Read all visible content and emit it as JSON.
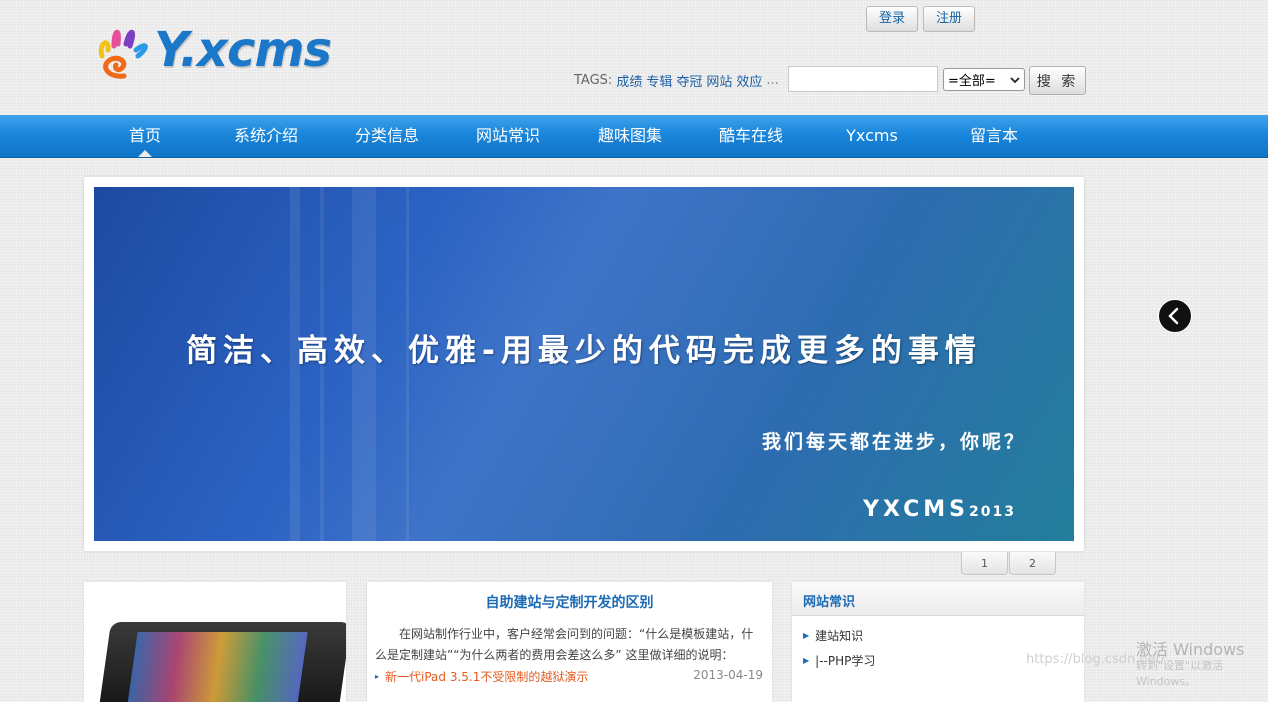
{
  "header": {
    "logo_text": "Y.xcms",
    "login_label": "登录",
    "register_label": "注册",
    "tags_label": "TAGS:",
    "tags": [
      "成绩",
      "专辑",
      "夺冠",
      "网站",
      "效应"
    ],
    "tags_more": "...",
    "search_value": "",
    "scope_selected": "=全部=",
    "search_button": "搜 索"
  },
  "nav": {
    "items": [
      {
        "label": "首页",
        "active": true
      },
      {
        "label": "系统介绍"
      },
      {
        "label": "分类信息"
      },
      {
        "label": "网站常识"
      },
      {
        "label": "趣味图集"
      },
      {
        "label": "酷车在线"
      },
      {
        "label": "Yxcms"
      },
      {
        "label": "留言本"
      }
    ]
  },
  "banner": {
    "headline": "简洁、高效、优雅-用最少的代码完成更多的事情",
    "subline": "我们每天都在进步，你呢？",
    "brand": "YXCMS",
    "year": "2013",
    "pages": [
      "1",
      "2"
    ],
    "colors": {
      "start": "#1d4aa0",
      "end": "#237e9b"
    }
  },
  "featured": {
    "title": "自助建站与定制开发的区别",
    "description": "在网站制作行业中，客户经常会问到的问题：“什么是模板建站，什么是定制建站”“为什么两者的费用会差这么多” 这里做详细的说明：",
    "news": [
      {
        "title": "新一代iPad 3.5.1不受限制的越狱演示",
        "date": "2013-04-19"
      }
    ]
  },
  "sidebar": {
    "title": "网站常识",
    "items": [
      "建站知识",
      "|--PHP学习"
    ]
  },
  "watermark": {
    "title": "激活 Windows",
    "subtitle": "转到\"设置\"以激活 Windows。",
    "url": "https://blog.csdn.net/"
  }
}
